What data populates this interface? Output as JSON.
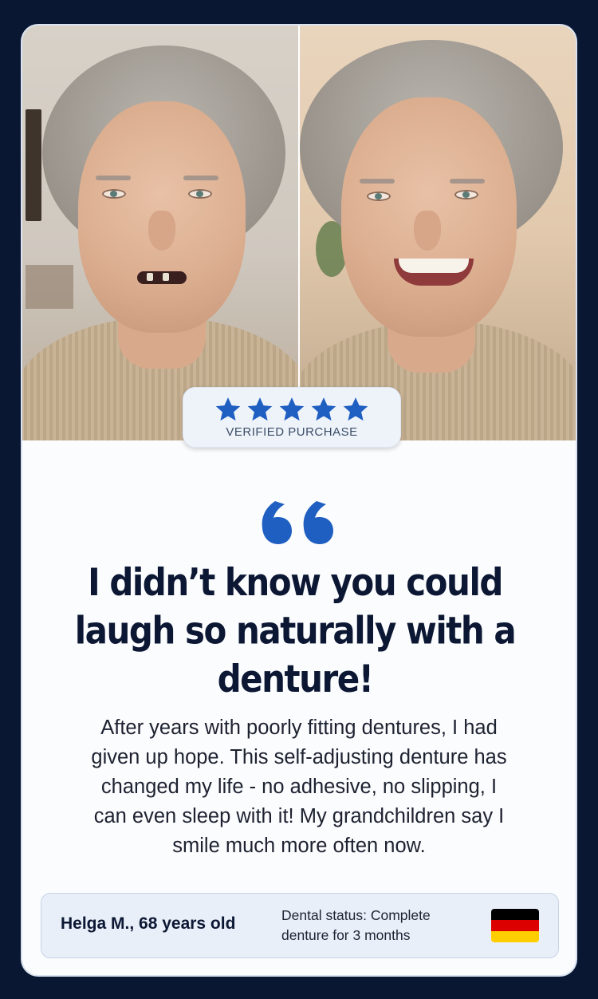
{
  "photos": {
    "before_alt": "Before",
    "after_alt": "After"
  },
  "rating": {
    "stars": 5,
    "max_stars": 5,
    "star_color": "#1f5fc1",
    "label": "VERIFIED PURCHASE"
  },
  "testimonial": {
    "quote_color": "#1f5fc1",
    "headline_lines": [
      "I didn’t know you could",
      "laugh so naturally with a",
      "denture!"
    ],
    "body_lines": [
      "After years with poorly fitting dentures, I had",
      "given up hope. This self-adjusting denture has",
      "changed my life - no adhesive, no slipping, I",
      "can even sleep with it! My grandchildren say I",
      "smile much more often now."
    ]
  },
  "footer": {
    "author": "Helga M., 68 years old",
    "status_lines": [
      "Dental status: Complete",
      "denture for 3 months"
    ],
    "flag_colors": [
      "#000000",
      "#dd0000",
      "#ffce00"
    ]
  }
}
